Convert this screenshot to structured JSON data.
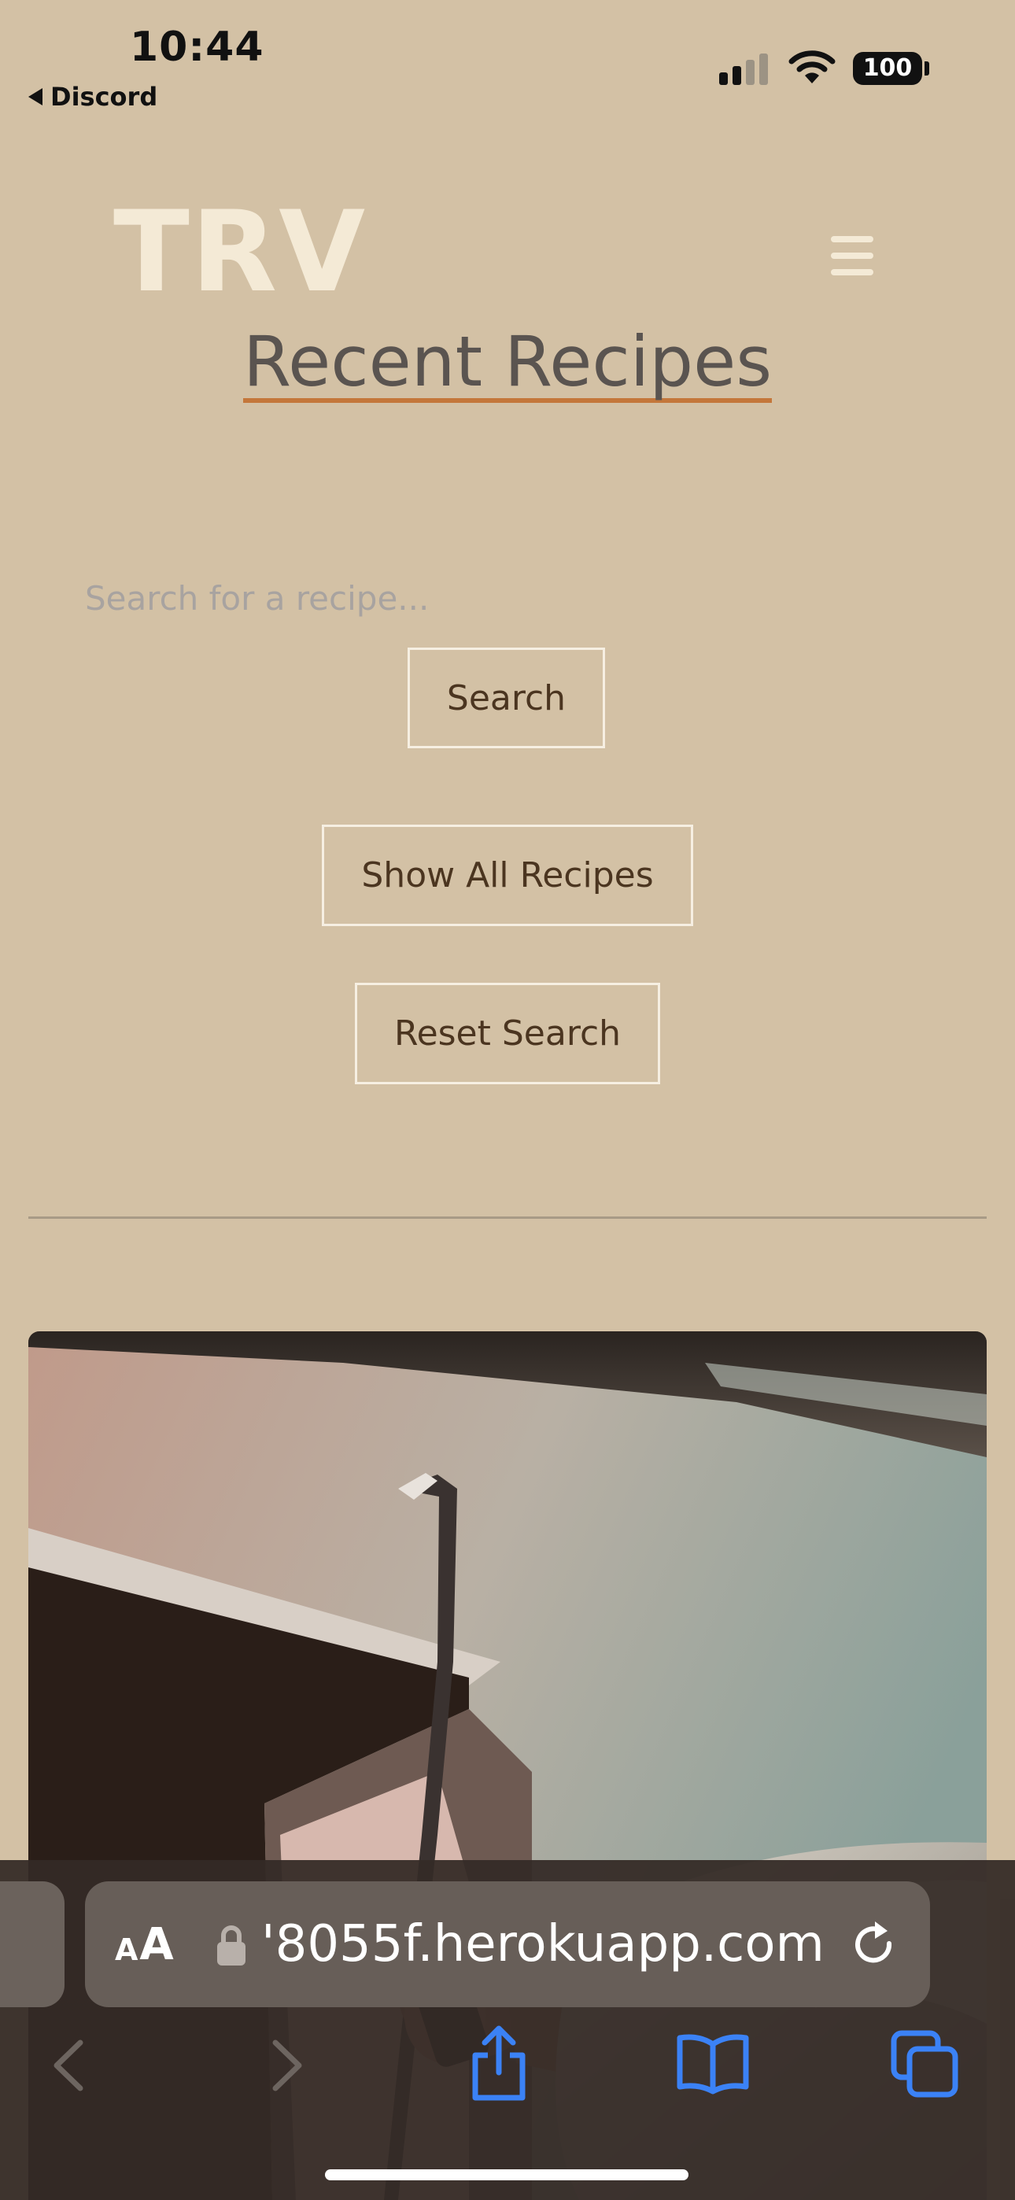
{
  "status_bar": {
    "time": "10:44",
    "back_app": "Discord",
    "battery": "100"
  },
  "header": {
    "brand": "TRV",
    "menu_icon": "hamburger-menu-icon"
  },
  "page": {
    "title": "Recent Recipes"
  },
  "search": {
    "placeholder": "Search for a recipe...",
    "value": "",
    "search_button": "Search",
    "show_all_button": "Show All Recipes",
    "reset_button": "Reset Search"
  },
  "recipe_card": {
    "image_icon": "recipe-photo"
  },
  "safari": {
    "aa_small": "A",
    "aa_big": "A",
    "url": "'8055f.herokuapp.com",
    "icons": [
      "back-icon",
      "forward-icon",
      "share-icon",
      "bookmarks-icon",
      "tabs-icon",
      "lock-icon",
      "reload-icon"
    ]
  },
  "colors": {
    "background": "#d3c1a5",
    "brand": "#f4ead6",
    "title": "#5a5450",
    "title_underline": "#c4773b",
    "button_text": "#4b3520",
    "button_border": "#f6efe2",
    "safari_accent": "#3b82f6"
  }
}
